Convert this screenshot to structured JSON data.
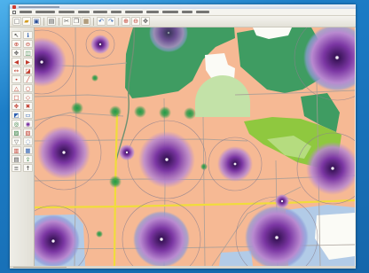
{
  "theme": {
    "frame_blue": "#1c7dc7",
    "window_chrome": "#ecebe4",
    "map_base": "#f6b994",
    "blue_zone": "#b2cbe7",
    "green_dark": "#3f9c62",
    "green_bright": "#8fc83f",
    "green_pale": "#c3e2a8",
    "road": "#a79d97",
    "main_road": "#f0dc3c",
    "hotspot_core": "#3a1459",
    "hotspot_mid": "#7b36a3",
    "hotspot_edge": "#b98ad0",
    "hotspot_edge_blue": "#8e9ad8",
    "green_point": "#1f9a45"
  },
  "titlebar": {
    "icon": "app-icon"
  },
  "toolbar": {
    "groups": [
      [
        "new-file-icon",
        "open-folder-icon",
        "save-icon"
      ],
      [
        "print-icon"
      ],
      [
        "cut-icon",
        "copy-icon",
        "paste-icon"
      ],
      [
        "undo-icon",
        "redo-icon"
      ],
      [
        "zoom-in-icon",
        "zoom-out-icon",
        "pan-icon"
      ]
    ]
  },
  "tool_palette": {
    "icons": [
      "select-icon",
      "identify-icon",
      "zoom-in-icon",
      "zoom-out-icon",
      "pan-icon",
      "full-extent-icon",
      "previous-extent-icon",
      "next-extent-icon",
      "measure-distance-icon",
      "measure-area-icon",
      "draw-point-icon",
      "draw-line-icon",
      "draw-polygon-icon",
      "draw-circle-icon",
      "draw-rectangle-icon",
      "edit-vertex-icon",
      "move-feature-icon",
      "delete-feature-icon",
      "label-icon",
      "text-icon",
      "buffer-icon",
      "heatmap-icon",
      "layer-add-icon",
      "layer-remove-icon",
      "filter-icon",
      "query-icon",
      "chart-icon",
      "table-icon",
      "print-map-icon",
      "export-icon",
      "legend-icon",
      "north-arrow-icon"
    ]
  }
}
